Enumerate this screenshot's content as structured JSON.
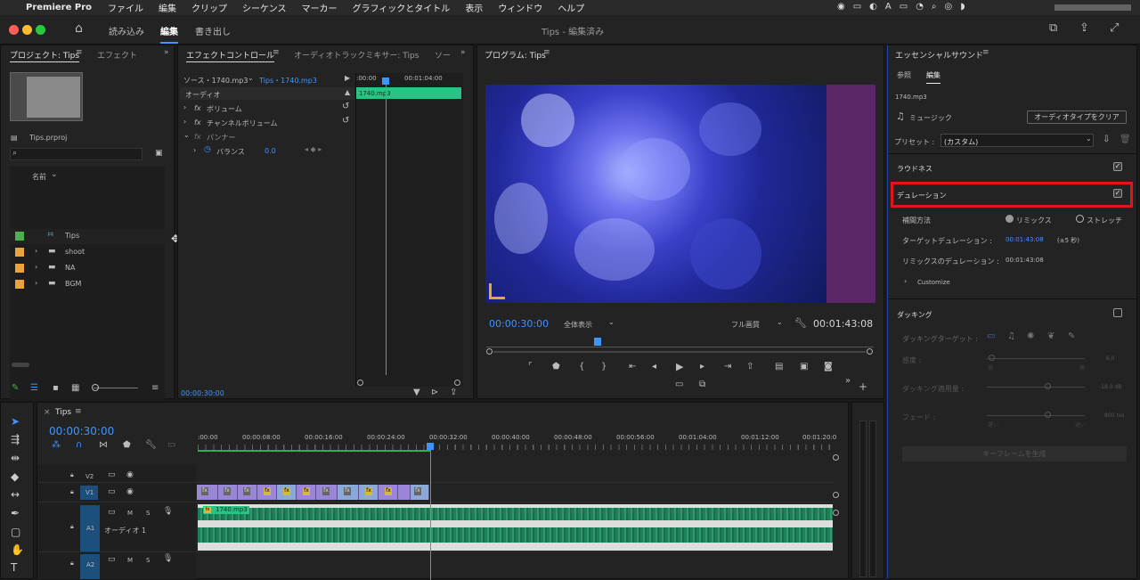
{
  "menubar": {
    "app": "Premiere Pro",
    "items": [
      "ファイル",
      "編集",
      "クリップ",
      "シーケンス",
      "マーカー",
      "グラフィックとタイトル",
      "表示",
      "ウィンドウ",
      "ヘルプ"
    ]
  },
  "titlebar": {
    "title": "Tips - 編集済み",
    "workspaces": {
      "import": "読み込み",
      "edit": "編集",
      "export": "書き出し"
    }
  },
  "project_panel": {
    "tab_active": "プロジェクト: Tips",
    "tab_other": "エフェクト",
    "file": "Tips.prproj",
    "column_name": "名前",
    "items": [
      {
        "name": "Tips",
        "type": "sequence",
        "color": "#4caf50"
      },
      {
        "name": "shoot",
        "type": "folder",
        "color": "#e8a33d"
      },
      {
        "name": "NA",
        "type": "folder",
        "color": "#e8a33d"
      },
      {
        "name": "BGM",
        "type": "folder",
        "color": "#e8a33d"
      }
    ]
  },
  "effect_controls": {
    "tab_active": "エフェクトコントロール",
    "tab_other": "オーディオトラックミキサー: Tips",
    "tab_more": "ソー",
    "source": "ソース・1740.mp3",
    "target": "Tips・1740.mp3",
    "section_audio": "オーディオ",
    "volume": "ボリューム",
    "channel_volume": "チャンネルボリューム",
    "panner": "パンナー",
    "balance": "バランス",
    "balance_value": "0.0",
    "ruler_start": ":00:00",
    "ruler_end": "00:01:04:00",
    "clip_name": "1740.mp3",
    "timecode": "00:00:30:00"
  },
  "program_monitor": {
    "tab": "プログラム: Tips",
    "current_time": "00:00:30:00",
    "zoom": "全体表示",
    "quality": "フル画質",
    "duration": "00:01:43:08"
  },
  "essential_sound": {
    "tab": "エッセンシャルサウンド",
    "subtab_browse": "参照",
    "subtab_edit": "編集",
    "clip": "1740.mp3",
    "type": "ミュージック",
    "clear_button": "オーディオタイプをクリア",
    "preset_label": "プリセット :",
    "preset_value": "(カスタム)",
    "loudness": "ラウドネス",
    "duration": "デュレーション",
    "method_label": "補間方法",
    "method_remix": "リミックス",
    "method_stretch": "ストレッチ",
    "target_label": "ターゲットデュレーション :",
    "target_value": "00:01:43:08",
    "target_tolerance": "(±5 秒)",
    "remix_label": "リミックスのデュレーション :",
    "remix_value": "00:01:43:08",
    "customize": "Customize",
    "ducking": "ダッキング",
    "ducking_target": "ダッキングターゲット :",
    "sensitivity": "感度 :",
    "sensitivity_value": "6.0",
    "duck_amount": "ダッキング適用量 :",
    "duck_amount_value": "-18.0 dB",
    "fade": "フェード :",
    "fade_value": "800 ms",
    "slow": "遅い",
    "fast": "速い",
    "low": "低",
    "high": "高",
    "keyframe_button": "キーフレームを生成"
  },
  "timeline": {
    "tab": "Tips",
    "timecode": "00:00:30:00",
    "ruler": [
      ":00:00",
      "00:00:08:00",
      "00:00:16:00",
      "00:00:24:00",
      "00:00:32:00",
      "00:00:40:00",
      "00:00:48:00",
      "00:00:56:00",
      "00:01:04:00",
      "00:01:12:00",
      "00:01:20:0"
    ],
    "tracks": {
      "v2": "V2",
      "v1": "V1",
      "a1": "A1",
      "a2": "A2",
      "a1_name": "オーディオ 1"
    },
    "audio_clip": "1740.mp3",
    "track_letters": {
      "m": "M",
      "s": "S"
    }
  },
  "colors": {
    "accent_blue": "#3f95ff",
    "highlight_red": "#e0161b",
    "audio_green": "#1f7f58",
    "clip_teal": "#27c486"
  }
}
